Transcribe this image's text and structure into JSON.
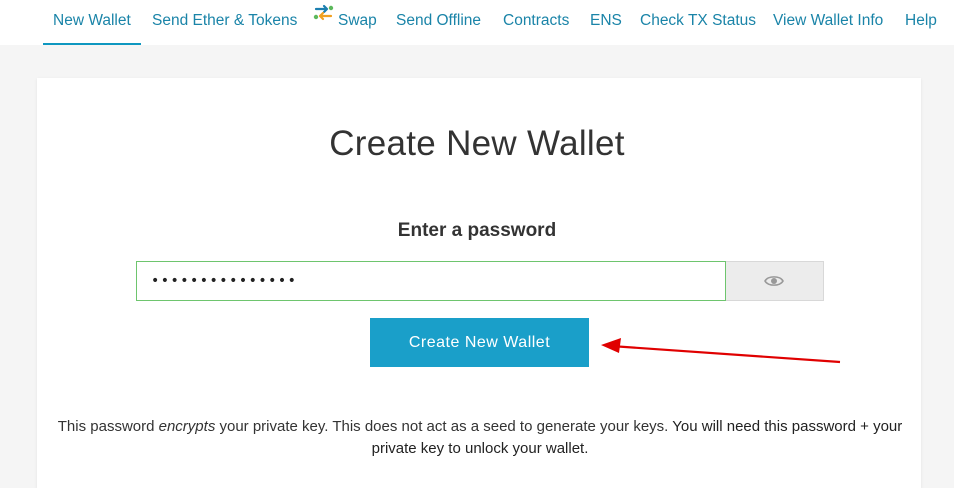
{
  "nav": {
    "items": [
      {
        "label": "New Wallet",
        "active": true
      },
      {
        "label": "Send Ether & Tokens"
      },
      {
        "label": "Swap",
        "icon": "swap-icon"
      },
      {
        "label": "Send Offline"
      },
      {
        "label": "Contracts"
      },
      {
        "label": "ENS"
      },
      {
        "label": "Check TX Status"
      },
      {
        "label": "View Wallet Info"
      },
      {
        "label": "Help"
      }
    ]
  },
  "main": {
    "title": "Create New Wallet",
    "password_label": "Enter a password",
    "password_value": "•••••••••••••••",
    "show_password_icon": "eye-icon",
    "create_button": "Create New Wallet",
    "info": {
      "part1": "This password ",
      "part2": "encrypts",
      "part3": " your private key. This does not act as a seed to generate your keys. ",
      "part4": "You will need this password + your private key to unlock your wallet."
    }
  },
  "colors": {
    "accent": "#1a9fc9",
    "nav_text": "#1a84a8",
    "annotation_arrow": "#e00000",
    "input_border": "#6ec56e"
  }
}
